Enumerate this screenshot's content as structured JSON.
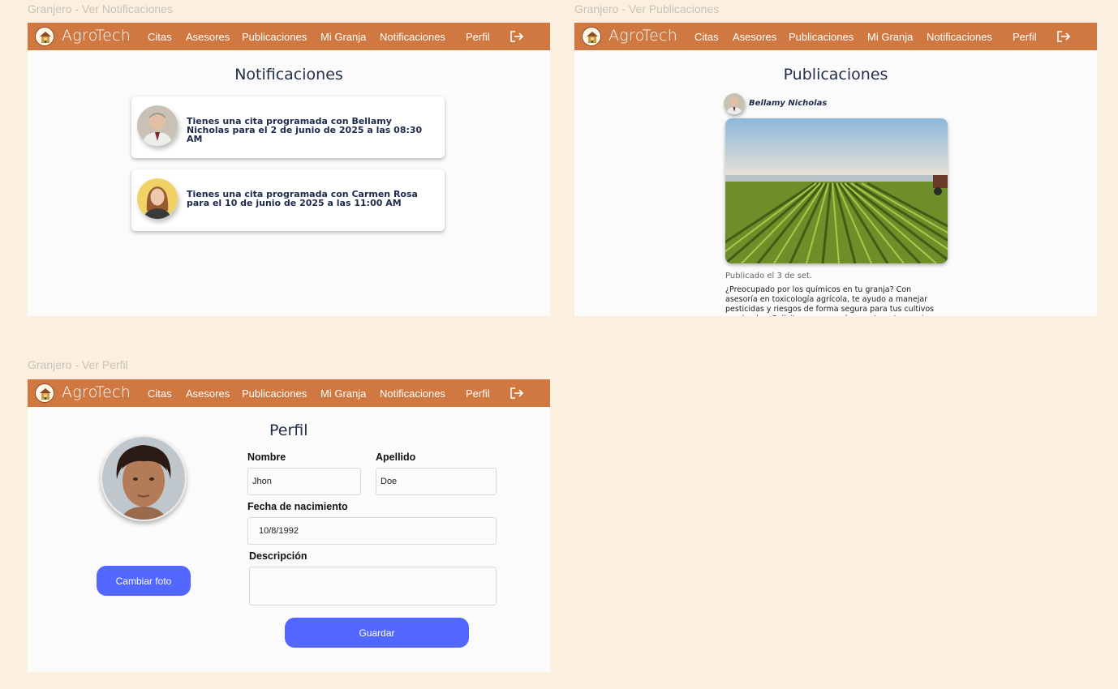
{
  "frames": {
    "notificaciones": {
      "label": "Granjero - Ver Notificaciones"
    },
    "publicaciones": {
      "label": "Granjero - Ver Publicaciones"
    },
    "perfil": {
      "label": "Granjero - Ver Perfil"
    }
  },
  "nav": {
    "brand": "AgroTech",
    "items": [
      "Citas",
      "Asesores",
      "Publicaciones",
      "Mi Granja",
      "Notificaciones",
      "Perfil"
    ],
    "color": "#CF7842"
  },
  "notifications": {
    "title": "Notificaciones",
    "items": [
      {
        "text": "Tienes una cita programada con Bellamy Nicholas para el 2 de junio de 2025 a las 08:30 AM"
      },
      {
        "text": "Tienes una cita programada con Carmen Rosa para el 10 de junio de 2025 a las 11:00 AM"
      }
    ]
  },
  "publications": {
    "title": "Publicaciones",
    "post": {
      "author": "Bellamy Nicholas",
      "date": "Publicado el 3 de set.",
      "body": "¿Preocupado por los químicos en tu granja? Con asesoría en toxicología agrícola, te ayudo a manejar pesticidas y riesgos de forma segura para tus cultivos y animales. Solicita una asesoría y protege tu granja."
    }
  },
  "profile": {
    "title": "Perfil",
    "change_photo": "Cambiar foto",
    "labels": {
      "first_name": "Nombre",
      "last_name": "Apellido",
      "birth_date": "Fecha de nacimiento",
      "description": "Descripción"
    },
    "values": {
      "first_name": "Jhon",
      "last_name": "Doe",
      "birth_date": "10/8/1992",
      "description": ""
    },
    "save": "Guardar",
    "accent": "#5267FF"
  }
}
